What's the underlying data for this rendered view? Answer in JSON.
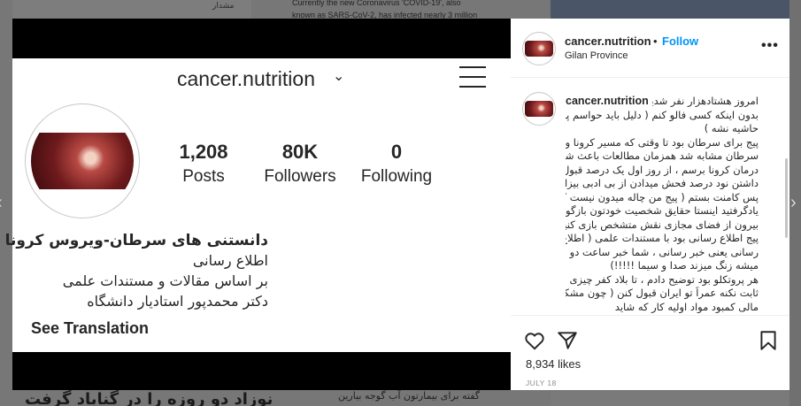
{
  "background": {
    "side_label": "مشدار",
    "article_lines": [
      "Currently the new Coronavirus 'COVID-19', also",
      "known as SARS-CoV-2, has infected nearly 3 million"
    ],
    "headline": "نوزاد دو روزه را در گناباد گرفت",
    "caption": "گفته برای بیمارتون آب گوجه بیارین",
    "nav_left": "‹",
    "nav_right": "›"
  },
  "screenshot": {
    "username": "cancer.nutrition",
    "chevron": "⌄",
    "stats": [
      {
        "num": "1,208",
        "label": "Posts"
      },
      {
        "num": "80K",
        "label": "Followers"
      },
      {
        "num": "0",
        "label": "Following"
      }
    ],
    "bio_name": "دانستنی های سرطان-ویروس کرونا",
    "bio_lines": [
      "اطلاع رسانی",
      "بر اساس مقالات و مستندات علمی",
      "دکتر محمدپور استادیار دانشگاه"
    ],
    "see_translation": "See Translation"
  },
  "post": {
    "username": "cancer.nutrition",
    "dot": "•",
    "follow_label": "Follow",
    "location": "Gilan Province",
    "more": "•••",
    "caption_user": "cancer.nutrition",
    "caption_lines": [
      "امروز هشتادهزار نفر شدیم",
      "بدون اینکه کسی فالو کنم ( دلیل باید حواسم پرت",
      "حاشیه نشه )",
      "پیج برای سرطان بود تا وقتی که مسیر کرونا و",
      "سرطان مشابه شد همزمان مطالعات باعث شد به",
      "درمان کرونا برسم ، از روز اول یک درصد قبول",
      "داشتن نود درصد فحش میدادن از بی ادبی بیزارم",
      "پس کامنت بستم ( پیج من چاله میدون نیست که",
      "یادگرفتید اینستا حقایق شخصیت خودتون بازگو کنید",
      "بیرون از فضای مجازی نقش متشخص بازی کنید )",
      "پیج اطلاع رسانی بود با مستندات علمی ( اطلاع",
      "رسانی یعنی خبر رسانی ، شما خبر ساعت دو نموم",
      "میشه زنگ میزند صدا و سیما !!!!!)",
      "هر پروتکلو بود توضیح دادم ، تا بلاد کفر چیزی",
      "ثابت نکنه عمراً تو ایران قبول کنن ( چون مشکل",
      "مالی کمبود مواد اولیه کار که شاید"
    ],
    "likes": "8,934 likes",
    "date": "JULY 18"
  }
}
